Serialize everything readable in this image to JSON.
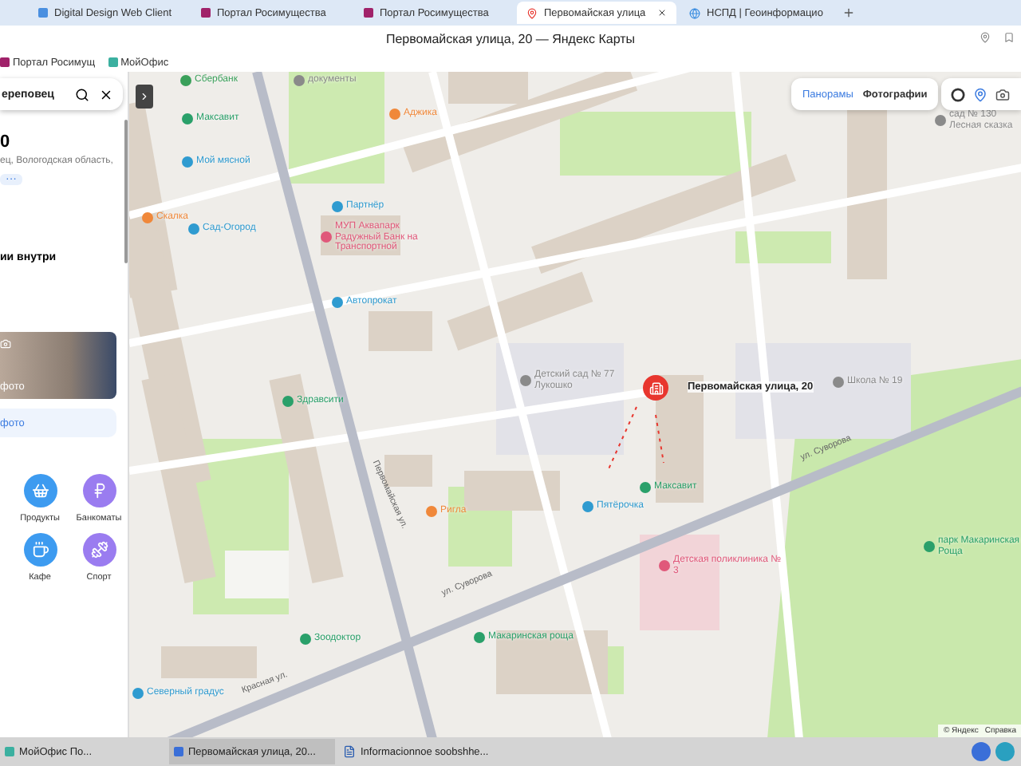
{
  "browser": {
    "tabs": [
      {
        "label": "Digital Design Web Client",
        "kind": "doc",
        "selected": false
      },
      {
        "label": "Портал Росимущества",
        "kind": "portal",
        "selected": false
      },
      {
        "label": "Портал Росимущества",
        "kind": "portal",
        "selected": false
      },
      {
        "label": "Первомайская улица",
        "kind": "map",
        "selected": true
      },
      {
        "label": "НСПД | Геоинформацио",
        "kind": "globe",
        "selected": false
      }
    ],
    "title": "Первомайская улица, 20 — Яндекс Карты",
    "bookmarks": [
      {
        "label": "Портал Росимущ",
        "kind": "portal"
      },
      {
        "label": "МойОфис",
        "kind": "office"
      }
    ]
  },
  "panel": {
    "search": {
      "value": "ереповец"
    },
    "title": "0",
    "address": "ец, Вологодская область,",
    "chip": "···",
    "section": "ии внутри",
    "photo_caption": "фото",
    "photo_button": "фото",
    "categories": [
      {
        "label": "Продукты",
        "kind": "basket",
        "color": "#3d9bf0"
      },
      {
        "label": "Банкоматы",
        "kind": "ruble",
        "color": "#9a7cf0"
      },
      {
        "label": "Кафе",
        "kind": "cup",
        "color": "#3d9bf0"
      },
      {
        "label": "Спорт",
        "kind": "dumbbell",
        "color": "#9a7cf0"
      }
    ]
  },
  "map": {
    "layer_buttons": [
      {
        "label": "Панорамы",
        "selected": true
      },
      {
        "label": "Фотографии",
        "selected": false
      }
    ],
    "places": [
      {
        "name": "Сбербанк",
        "color": "#3aa05a"
      },
      {
        "name": "документы",
        "color": "#8a8a8a"
      },
      {
        "name": "Максавит",
        "color": "#2aa06a"
      },
      {
        "name": "Мой мясной",
        "color": "#2f9bd0"
      },
      {
        "name": "Аджика",
        "color": "#f0883a"
      },
      {
        "name": "Скалка",
        "color": "#f0883a"
      },
      {
        "name": "Сад-Огород",
        "color": "#2f9bd0"
      },
      {
        "name": "Партнёр",
        "color": "#2f9bd0"
      },
      {
        "name": "МУП Аквапарк Радужный Банк на Транспортной",
        "color": "#e0587a"
      },
      {
        "name": "Автопрокат",
        "color": "#2f9bd0"
      },
      {
        "name": "Детский сад № 77 Лукошко",
        "color": "#8a8a8a"
      },
      {
        "name": "Школа № 19",
        "color": "#8a8a8a"
      },
      {
        "name": "Здравсити",
        "color": "#2aa06a"
      },
      {
        "name": "Ригла",
        "color": "#f0883a"
      },
      {
        "name": "Пятёрочка",
        "color": "#2f9bd0"
      },
      {
        "name": "Максавит",
        "color": "#2aa06a"
      },
      {
        "name": "Детская поликлиника № 3",
        "color": "#e0587a"
      },
      {
        "name": "парк Макаринская Роща",
        "color": "#2aa06a"
      },
      {
        "name": "Зоодоктор",
        "color": "#2aa06a"
      },
      {
        "name": "Макаринская роща",
        "color": "#2aa06a"
      },
      {
        "name": "Северный градус",
        "color": "#2f9bd0"
      },
      {
        "name": "сад № 130 Лесная сказка",
        "color": "#8a8a8a"
      }
    ],
    "selected_place": "Первомайская улица, 20",
    "streets": [
      "ул. Суворова",
      "ул. Суворова",
      "Первомайская ул.",
      "Красная ул."
    ],
    "footer": [
      "© Яндекс",
      "Справка"
    ]
  },
  "taskbar": {
    "items": [
      {
        "label": "МойОфис По...",
        "kind": "office",
        "selected": false
      },
      {
        "label": "Первомайская улица, 20...",
        "kind": "browser",
        "selected": true
      },
      {
        "label": "Informacionnoe soobshhe...",
        "kind": "doc",
        "selected": false
      }
    ]
  }
}
